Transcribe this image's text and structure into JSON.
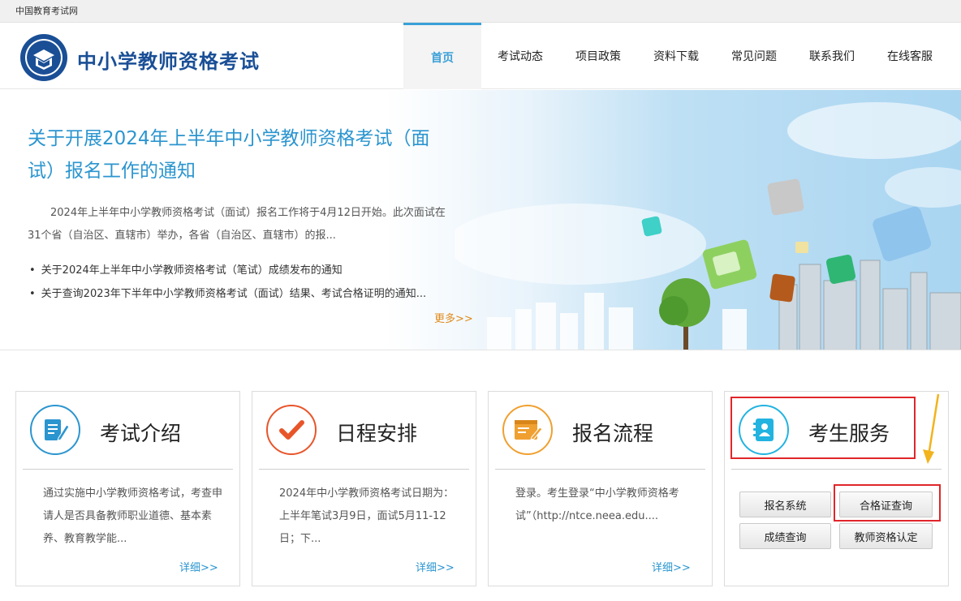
{
  "topbar": {
    "link": "中国教育考试网"
  },
  "header": {
    "site_title": "中小学教师资格考试",
    "nav": [
      "首页",
      "考试动态",
      "项目政策",
      "资料下载",
      "常见问题",
      "联系我们",
      "在线客服"
    ]
  },
  "banner": {
    "title": "关于开展2024年上半年中小学教师资格考试（面试）报名工作的通知",
    "summary": "2024年上半年中小学教师资格考试（面试）报名工作将于4月12日开始。此次面试在31个省（自治区、直辖市）举办，各省（自治区、直辖市）的报...",
    "news": [
      "关于2024年上半年中小学教师资格考试（笔试）成绩发布的通知",
      "关于查询2023年下半年中小学教师资格考试（面试）结果、考试合格证明的通知..."
    ],
    "more": "更多>>"
  },
  "cards": [
    {
      "title": "考试介绍",
      "desc": "通过实施中小学教师资格考试，考查申请人是否具备教师职业道德、基本素养、教育教学能...",
      "detail": "详细>>",
      "icon": "document-pen-icon"
    },
    {
      "title": "日程安排",
      "desc": "2024年中小学教师资格考试日期为：上半年笔试3月9日，面试5月11-12日；下...",
      "detail": "详细>>",
      "icon": "checkmark-icon"
    },
    {
      "title": "报名流程",
      "desc": "登录。考生登录“中小学教师资格考试”（http://ntce.neea.edu....",
      "detail": "详细>>",
      "icon": "form-edit-icon"
    }
  ],
  "service": {
    "title": "考生服务",
    "icon": "contacts-book-icon",
    "buttons": [
      "报名系统",
      "合格证查询",
      "成绩查询",
      "教师资格认定"
    ]
  },
  "colors": {
    "brand": "#1a4f96",
    "accent": "#2b95cf",
    "highlight": "#e0262a",
    "more": "#e18a1a"
  }
}
